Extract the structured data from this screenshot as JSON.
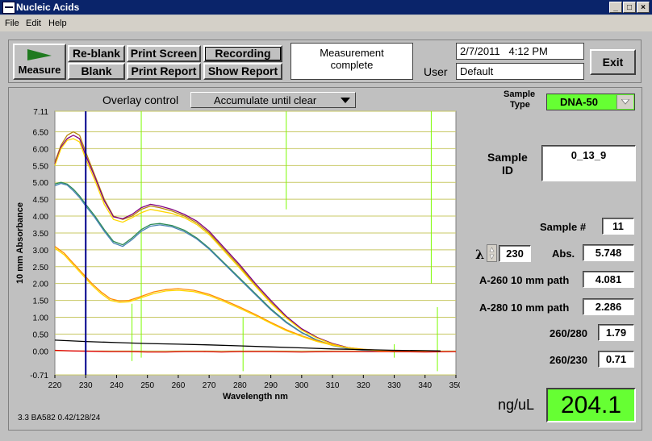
{
  "window": {
    "title": "Nucleic Acids",
    "controls": {
      "minimize": "_",
      "maximize": "□",
      "close": "×"
    }
  },
  "menu": {
    "file": "File",
    "edit": "Edit",
    "help": "Help"
  },
  "toolbar": {
    "measure": "Measure",
    "reblank": "Re-blank",
    "blank": "Blank",
    "print_screen": "Print Screen",
    "print_report": "Print Report",
    "recording": "Recording",
    "show_report": "Show Report",
    "status_line1": "Measurement",
    "status_line2": "complete",
    "datetime": "2/7/2011   4:12 PM",
    "user_label": "User",
    "user_value": "Default",
    "exit": "Exit"
  },
  "overlay": {
    "label": "Overlay control",
    "value": "Accumulate until clear"
  },
  "sample": {
    "type_label_1": "Sample",
    "type_label_2": "Type",
    "type_value": "DNA-50",
    "id_label_1": "Sample",
    "id_label_2": "ID",
    "id_value": "0_13_9",
    "number_label": "Sample #",
    "number_value": "11",
    "lambda_symbol": "λ",
    "lambda_value": "230",
    "abs_label": "Abs.",
    "abs_value": "5.748",
    "a260_label": "A-260 10 mm path",
    "a260_value": "4.081",
    "a280_label": "A-280 10 mm path",
    "a280_value": "2.286",
    "r260_280_label": "260/280",
    "r260_280_value": "1.79",
    "r260_230_label": "260/230",
    "r260_230_value": "0.71",
    "conc_label": "ng/uL",
    "conc_value": "204.1"
  },
  "footer": {
    "version": "3.3 BA582 0.42/128/24"
  },
  "colors": {
    "conc_bg": "#66ff33",
    "type_bg": "#66ff33",
    "title_bg": "#0a246a",
    "measure_icon": "#1f7a1f"
  },
  "chart_data": {
    "type": "line",
    "xlabel": "Wavelength nm",
    "ylabel": "10 mm Absorbance",
    "xlim": [
      220,
      350
    ],
    "ylim": [
      -0.71,
      7.11
    ],
    "x_ticks": [
      220,
      230,
      240,
      250,
      260,
      270,
      280,
      290,
      300,
      310,
      320,
      330,
      340,
      350
    ],
    "y_ticks": [
      "7.11",
      "6.50",
      "6.00",
      "5.50",
      "5.00",
      "4.50",
      "4.00",
      "3.50",
      "3.00",
      "2.50",
      "2.00",
      "1.50",
      "1.00",
      "0.50",
      "0.00",
      "-0.71"
    ],
    "grid": true,
    "cursor_x": 230,
    "series": [
      {
        "color": "#b8860b",
        "x": [
          220,
          222,
          224,
          226,
          228,
          230,
          233,
          236,
          239,
          242,
          245,
          248,
          251,
          254,
          258,
          262,
          266,
          270,
          275,
          280,
          285,
          290,
          295,
          300,
          305,
          310,
          315,
          320,
          325,
          330,
          335,
          340,
          345
        ],
        "y": [
          5.6,
          6.1,
          6.4,
          6.5,
          6.4,
          5.9,
          5.2,
          4.5,
          4.0,
          3.9,
          4.0,
          4.2,
          4.3,
          4.25,
          4.15,
          4.0,
          3.8,
          3.5,
          3.0,
          2.5,
          1.95,
          1.45,
          1.0,
          0.65,
          0.4,
          0.22,
          0.1,
          0.04,
          0.0,
          -0.02,
          -0.02,
          -0.02,
          -0.02
        ]
      },
      {
        "color": "#800080",
        "x": [
          220,
          222,
          224,
          226,
          228,
          230,
          233,
          236,
          239,
          242,
          245,
          248,
          251,
          254,
          258,
          262,
          266,
          270,
          275,
          280,
          285,
          290,
          295,
          300,
          305,
          310,
          315,
          320,
          325,
          330,
          335,
          340,
          345
        ],
        "y": [
          5.55,
          6.05,
          6.3,
          6.4,
          6.3,
          5.8,
          5.15,
          4.45,
          3.98,
          3.92,
          4.05,
          4.25,
          4.35,
          4.3,
          4.2,
          4.05,
          3.85,
          3.55,
          3.05,
          2.55,
          2.0,
          1.5,
          1.03,
          0.66,
          0.4,
          0.22,
          0.1,
          0.04,
          0.0,
          -0.02,
          -0.02,
          -0.02,
          -0.02
        ]
      },
      {
        "color": "#ffd700",
        "x": [
          220,
          222,
          224,
          226,
          228,
          230,
          233,
          236,
          239,
          242,
          245,
          248,
          251,
          254,
          258,
          262,
          266,
          270,
          275,
          280,
          285,
          290,
          295,
          300,
          305,
          310,
          315,
          320,
          325,
          330,
          335,
          340,
          345
        ],
        "y": [
          5.5,
          6.0,
          6.25,
          6.3,
          6.2,
          5.7,
          5.05,
          4.35,
          3.9,
          3.82,
          3.95,
          4.1,
          4.2,
          4.15,
          4.08,
          3.95,
          3.75,
          3.45,
          2.95,
          2.45,
          1.92,
          1.42,
          0.98,
          0.62,
          0.38,
          0.2,
          0.09,
          0.03,
          0.0,
          -0.02,
          -0.02,
          -0.02,
          -0.02
        ]
      },
      {
        "color": "#2e8b57",
        "x": [
          220,
          222,
          224,
          226,
          228,
          230,
          233,
          236,
          239,
          242,
          245,
          248,
          251,
          254,
          258,
          262,
          266,
          270,
          275,
          280,
          285,
          290,
          295,
          300,
          305,
          310,
          315,
          320,
          325,
          330,
          335,
          340,
          345
        ],
        "y": [
          4.95,
          5.0,
          4.95,
          4.8,
          4.6,
          4.35,
          4.0,
          3.6,
          3.25,
          3.15,
          3.35,
          3.6,
          3.75,
          3.78,
          3.72,
          3.58,
          3.35,
          3.05,
          2.6,
          2.15,
          1.7,
          1.25,
          0.86,
          0.55,
          0.32,
          0.17,
          0.08,
          0.03,
          0.0,
          -0.02,
          -0.02,
          -0.02,
          -0.02
        ]
      },
      {
        "color": "#4682b4",
        "x": [
          220,
          222,
          224,
          226,
          228,
          230,
          233,
          236,
          239,
          242,
          245,
          248,
          251,
          254,
          258,
          262,
          266,
          270,
          275,
          280,
          285,
          290,
          295,
          300,
          305,
          310,
          315,
          320,
          325,
          330,
          335,
          340,
          345
        ],
        "y": [
          4.9,
          4.97,
          4.92,
          4.75,
          4.55,
          4.3,
          3.95,
          3.55,
          3.2,
          3.1,
          3.3,
          3.55,
          3.7,
          3.74,
          3.68,
          3.54,
          3.32,
          3.02,
          2.57,
          2.12,
          1.67,
          1.22,
          0.84,
          0.54,
          0.31,
          0.16,
          0.07,
          0.02,
          0.0,
          -0.02,
          -0.02,
          -0.02,
          -0.02
        ]
      },
      {
        "color": "#ff8c00",
        "x": [
          220,
          223,
          226,
          229,
          232,
          235,
          238,
          241,
          244,
          248,
          252,
          256,
          260,
          265,
          270,
          275,
          280,
          285,
          290,
          295,
          300,
          305,
          310,
          315,
          320,
          325,
          330,
          335,
          340,
          345
        ],
        "y": [
          3.1,
          2.9,
          2.6,
          2.3,
          2.0,
          1.75,
          1.55,
          1.48,
          1.5,
          1.62,
          1.75,
          1.82,
          1.85,
          1.8,
          1.68,
          1.5,
          1.3,
          1.08,
          0.85,
          0.63,
          0.45,
          0.3,
          0.18,
          0.1,
          0.05,
          0.02,
          0.0,
          -0.02,
          -0.02,
          -0.02
        ]
      },
      {
        "color": "#ffd700",
        "x": [
          220,
          223,
          226,
          229,
          232,
          235,
          238,
          241,
          244,
          248,
          252,
          256,
          260,
          265,
          270,
          275,
          280,
          285,
          290,
          295,
          300,
          305,
          310,
          315,
          320,
          325,
          330,
          335,
          340,
          345
        ],
        "y": [
          3.05,
          2.85,
          2.55,
          2.25,
          1.95,
          1.7,
          1.5,
          1.44,
          1.46,
          1.58,
          1.7,
          1.78,
          1.8,
          1.76,
          1.64,
          1.46,
          1.26,
          1.05,
          0.82,
          0.6,
          0.43,
          0.28,
          0.17,
          0.09,
          0.04,
          0.01,
          0.0,
          -0.02,
          -0.02,
          -0.02
        ]
      },
      {
        "color": "#e00000",
        "x": [
          220,
          226,
          232,
          238,
          244,
          250,
          256,
          262,
          268,
          274,
          280,
          290,
          300,
          310,
          320,
          330,
          340,
          350
        ],
        "y": [
          0.02,
          0.0,
          -0.01,
          -0.02,
          -0.02,
          -0.03,
          -0.03,
          -0.02,
          -0.02,
          -0.03,
          -0.02,
          -0.02,
          -0.03,
          -0.02,
          -0.02,
          -0.02,
          -0.03,
          -0.02
        ]
      },
      {
        "color": "#000000",
        "x": [
          220,
          230,
          240,
          250,
          260,
          270,
          280,
          290,
          300,
          310,
          320,
          330,
          340,
          345
        ],
        "y": [
          0.32,
          0.28,
          0.25,
          0.22,
          0.2,
          0.18,
          0.15,
          0.12,
          0.09,
          0.06,
          0.04,
          0.02,
          0.01,
          0.0
        ]
      }
    ]
  }
}
